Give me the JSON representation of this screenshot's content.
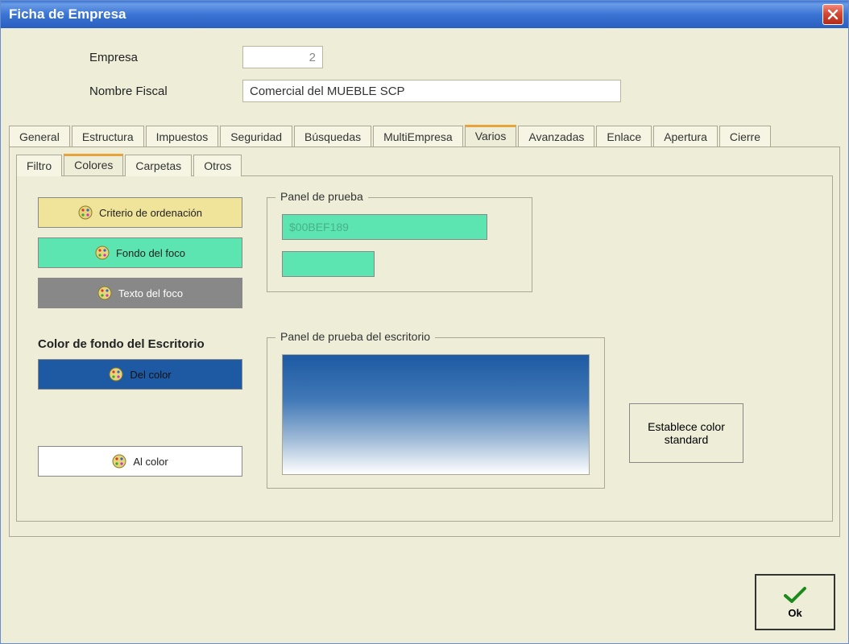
{
  "window": {
    "title": "Ficha de Empresa"
  },
  "header": {
    "empresa_label": "Empresa",
    "empresa_value": "2",
    "nombre_label": "Nombre Fiscal",
    "nombre_value": "Comercial del MUEBLE SCP"
  },
  "main_tabs": {
    "general": "General",
    "estructura": "Estructura",
    "impuestos": "Impuestos",
    "seguridad": "Seguridad",
    "busquedas": "Búsquedas",
    "multiempresa": "MultiEmpresa",
    "varios": "Varios",
    "avanzadas": "Avanzadas",
    "enlace": "Enlace",
    "apertura": "Apertura",
    "cierre": "Cierre",
    "active": "varios"
  },
  "sub_tabs": {
    "filtro": "Filtro",
    "colores": "Colores",
    "carpetas": "Carpetas",
    "otros": "Otros",
    "active": "colores"
  },
  "focus_colors": {
    "criterio_btn": "Criterio de ordenación",
    "fondo_foco_btn": "Fondo del foco",
    "texto_foco_btn": "Texto del foco",
    "panel_prueba_legend": "Panel de prueba",
    "panel_prueba_value": "$00BEF189",
    "criterio_color": "#f0e49a",
    "fondo_foco_color": "#5ce5b0",
    "texto_foco_color": "#888888"
  },
  "desktop_colors": {
    "section_label": "Color de fondo del Escritorio",
    "del_color_btn": "Del color",
    "al_color_btn": "Al color",
    "panel_legend": "Panel de prueba del escritorio",
    "standard_btn": "Establece color standard",
    "del_color": "#1d5aa3",
    "al_color": "#ffffff"
  },
  "footer": {
    "ok": "Ok"
  }
}
